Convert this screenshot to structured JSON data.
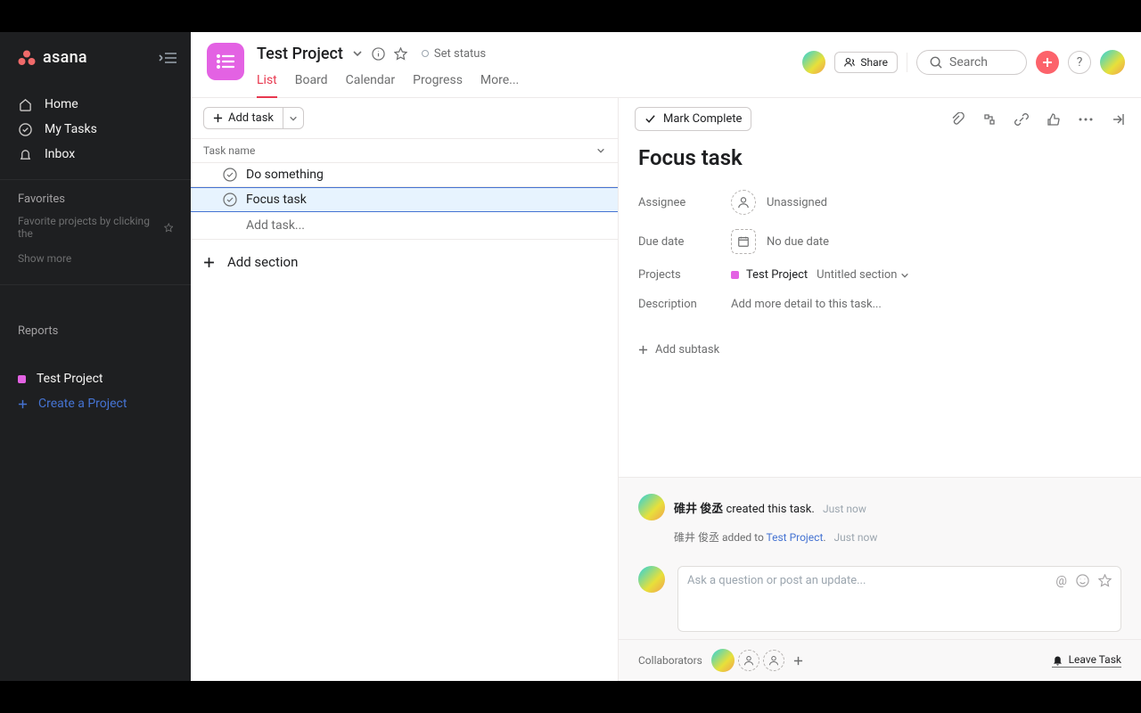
{
  "sidebar": {
    "logo_text": "asana",
    "nav": {
      "home": "Home",
      "mytasks": "My Tasks",
      "inbox": "Inbox"
    },
    "favorites_heading": "Favorites",
    "favorites_hint": "Favorite projects by clicking the",
    "show_more": "Show more",
    "reports_heading": "Reports",
    "project_item": "Test Project",
    "create_project": "Create a Project"
  },
  "header": {
    "project_title": "Test Project",
    "set_status": "Set status",
    "tabs": {
      "list": "List",
      "board": "Board",
      "calendar": "Calendar",
      "progress": "Progress",
      "more": "More..."
    },
    "share": "Share",
    "search_placeholder": "Search"
  },
  "list": {
    "add_task_btn": "Add task",
    "column_header": "Task name",
    "tasks": [
      "Do something",
      "Focus task"
    ],
    "add_task_placeholder": "Add task...",
    "add_section": "Add section"
  },
  "detail": {
    "mark_complete": "Mark Complete",
    "title": "Focus task",
    "assignee_label": "Assignee",
    "assignee_value": "Unassigned",
    "due_label": "Due date",
    "due_value": "No due date",
    "projects_label": "Projects",
    "project_value": "Test Project",
    "section_value": "Untitled section",
    "description_label": "Description",
    "description_placeholder": "Add more detail to this task...",
    "add_subtask": "Add subtask"
  },
  "activity": {
    "author": "碓井 俊丞",
    "created_text": " created this task.",
    "created_time": "Just now",
    "added_text": " added to ",
    "added_project": "Test Project",
    "added_suffix": ".",
    "added_time": "Just now"
  },
  "comment_placeholder": "Ask a question or post an update...",
  "footer": {
    "collaborators": "Collaborators",
    "leave": "Leave Task"
  }
}
